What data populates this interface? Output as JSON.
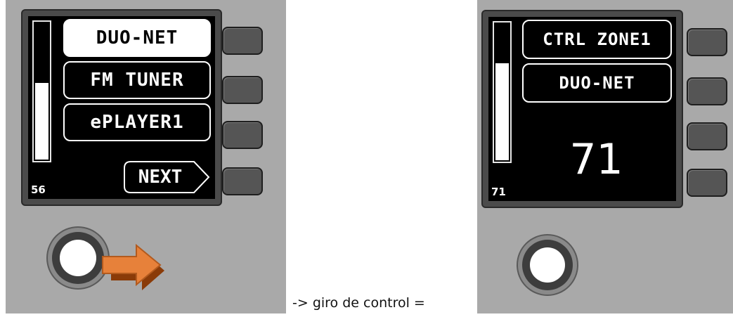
{
  "left_panel": {
    "menu_items": [
      "DUO-NET",
      "FM TUNER",
      "ePLAYER1"
    ],
    "selected_index": 0,
    "next_label": "NEXT",
    "level_value": "56",
    "level_fraction": 0.56
  },
  "right_panel": {
    "menu_items": [
      "CTRL ZONE1",
      "DUO-NET"
    ],
    "level_value": "71",
    "level_fraction": 0.71,
    "big_value": "71"
  },
  "caption": "-> giro de control =",
  "colors": {
    "arrow": "#e7813a",
    "arrow_dark": "#8a3b08",
    "panel": "#a9a9a9"
  },
  "icons": {
    "rotate_arrow": "arrow-right-icon"
  }
}
